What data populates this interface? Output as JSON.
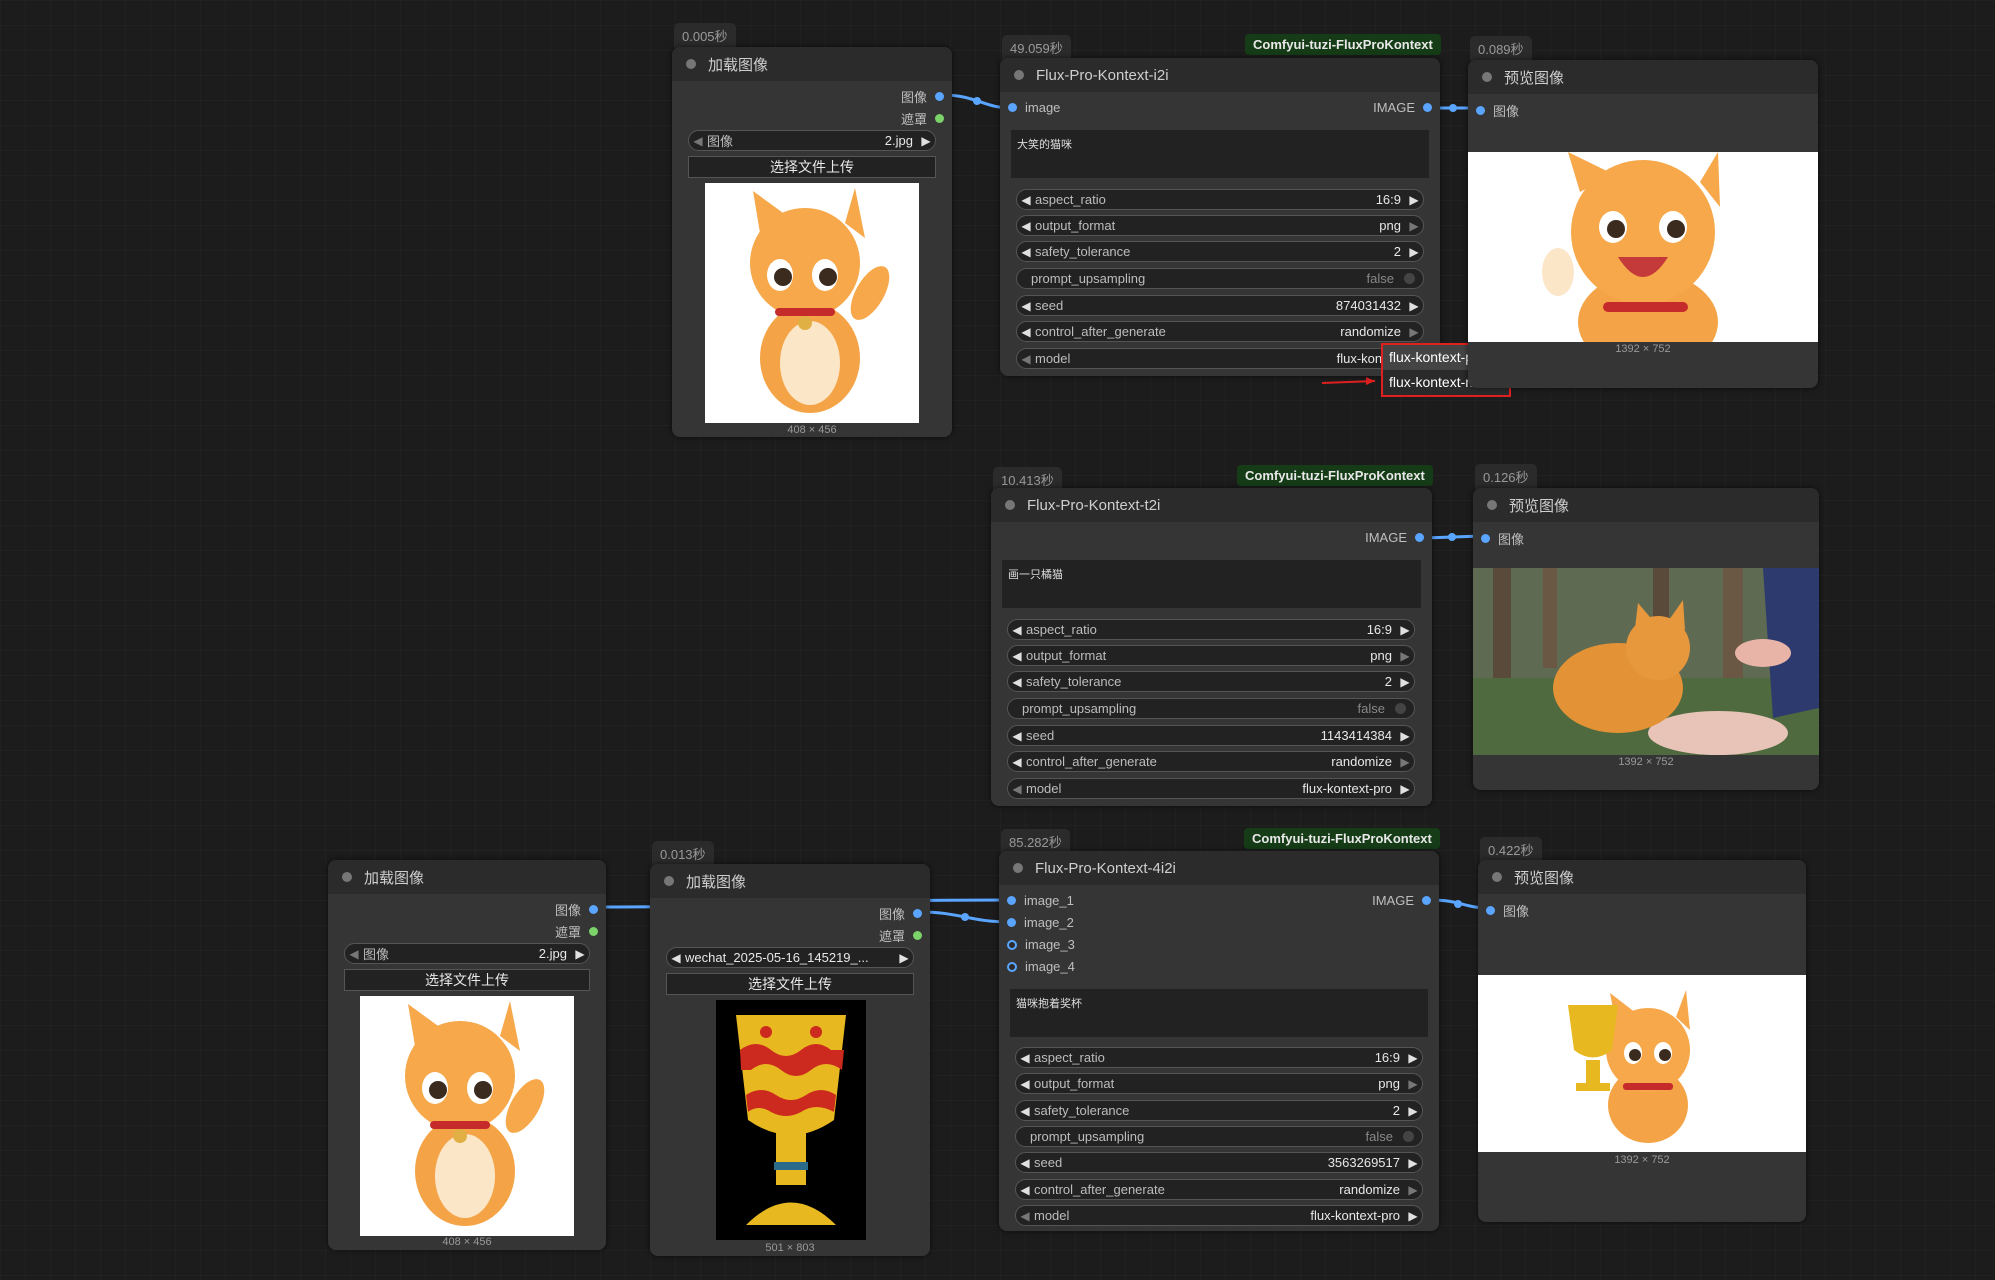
{
  "nodes": {
    "load1": {
      "timing": "0.005秒",
      "title": "加载图像",
      "out_image": "图像",
      "out_mask": "遮罩",
      "widget_label": "图像",
      "widget_value": "2.jpg",
      "upload": "选择文件上传",
      "dims": "408 × 456"
    },
    "flux_i2i": {
      "timing": "49.059秒",
      "badge": "Comfyui-tuzi-FluxProKontext",
      "title": "Flux-Pro-Kontext-i2i",
      "in_image": "image",
      "out_image": "IMAGE",
      "prompt": "大笑的猫咪",
      "aspect_ratio": "16:9",
      "output_format": "png",
      "safety_tolerance": "2",
      "prompt_upsampling": "false",
      "seed": "874031432",
      "control_after_generate": "randomize",
      "model": "flux-kontext-pr"
    },
    "preview1": {
      "timing": "0.089秒",
      "title": "预览图像",
      "in_image": "图像",
      "dims": "1392 × 752"
    },
    "dropdown": {
      "options": [
        "flux-kontext-pro",
        "flux-kontext-max"
      ]
    },
    "flux_t2i": {
      "timing": "10.413秒",
      "badge": "Comfyui-tuzi-FluxProKontext",
      "title": "Flux-Pro-Kontext-t2i",
      "out_image": "IMAGE",
      "prompt": "画一只橘猫",
      "aspect_ratio": "16:9",
      "output_format": "png",
      "safety_tolerance": "2",
      "prompt_upsampling": "false",
      "seed": "1143414384",
      "control_after_generate": "randomize",
      "model": "flux-kontext-pro"
    },
    "preview2": {
      "timing": "0.126秒",
      "title": "预览图像",
      "in_image": "图像",
      "dims": "1392 × 752"
    },
    "load2": {
      "title": "加载图像",
      "out_image": "图像",
      "out_mask": "遮罩",
      "widget_label": "图像",
      "widget_value": "2.jpg",
      "upload": "选择文件上传",
      "dims": "408 × 456"
    },
    "load3": {
      "timing": "0.013秒",
      "title": "加载图像",
      "out_image": "图像",
      "out_mask": "遮罩",
      "widget_value": "wechat_2025-05-16_145219_...",
      "upload": "选择文件上传",
      "dims": "501 × 803"
    },
    "flux_4i2i": {
      "timing": "85.282秒",
      "badge": "Comfyui-tuzi-FluxProKontext",
      "title": "Flux-Pro-Kontext-4i2i",
      "in1": "image_1",
      "in2": "image_2",
      "in3": "image_3",
      "in4": "image_4",
      "out_image": "IMAGE",
      "prompt": "猫咪抱着奖杯",
      "aspect_ratio": "16:9",
      "output_format": "png",
      "safety_tolerance": "2",
      "prompt_upsampling": "false",
      "seed": "3563269517",
      "control_after_generate": "randomize",
      "model": "flux-kontext-pro"
    },
    "preview3": {
      "timing": "0.422秒",
      "title": "预览图像",
      "in_image": "图像",
      "dims": "1392 × 752"
    }
  },
  "labels": {
    "aspect_ratio": "aspect_ratio",
    "output_format": "output_format",
    "safety_tolerance": "safety_tolerance",
    "prompt_upsampling": "prompt_upsampling",
    "seed": "seed",
    "control_after_generate": "control_after_generate",
    "model": "model"
  },
  "colors": {
    "canvas": "#1c1c1c",
    "node": "#353535",
    "link": "#5aa5ff",
    "badge": "#153c16",
    "highlight": "#e02020"
  }
}
